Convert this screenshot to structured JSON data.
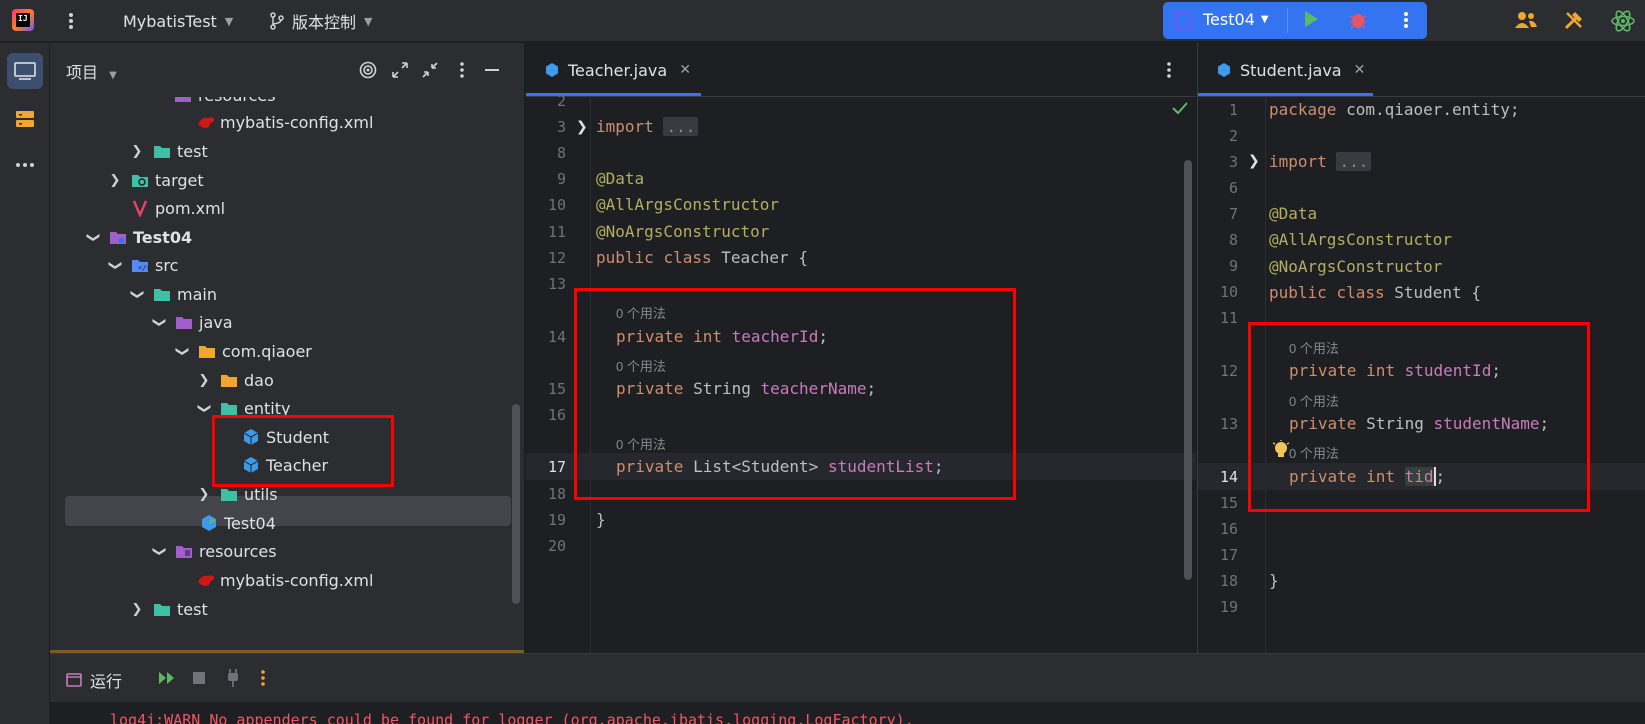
{
  "topbar": {
    "project_name": "MybatisTest",
    "vcs_label": "版本控制",
    "run_config": "Test04"
  },
  "project_panel": {
    "title": "项目",
    "tree": [
      {
        "label": "resources",
        "depth": 5
      },
      {
        "label": "mybatis-config.xml",
        "depth": 6
      },
      {
        "label": "test",
        "depth": 3
      },
      {
        "label": "target",
        "depth": 2
      },
      {
        "label": "pom.xml",
        "depth": 2
      },
      {
        "label": "Test04",
        "depth": 1
      },
      {
        "label": "src",
        "depth": 2
      },
      {
        "label": "main",
        "depth": 3
      },
      {
        "label": "java",
        "depth": 4
      },
      {
        "label": "com.qiaoer",
        "depth": 5
      },
      {
        "label": "dao",
        "depth": 6
      },
      {
        "label": "entity",
        "depth": 6
      },
      {
        "label": "Student",
        "depth": 7
      },
      {
        "label": "Teacher",
        "depth": 7
      },
      {
        "label": "utils",
        "depth": 6
      },
      {
        "label": "Test04",
        "depth": 5
      },
      {
        "label": "resources",
        "depth": 4
      },
      {
        "label": "mybatis-config.xml",
        "depth": 5
      },
      {
        "label": "test",
        "depth": 3
      }
    ]
  },
  "editor_left": {
    "tab": "Teacher.java",
    "lines": [
      "2",
      "3",
      "8",
      "9",
      "10",
      "11",
      "12",
      "13",
      "14",
      "15",
      "16",
      "17",
      "18",
      "19",
      "20"
    ],
    "code": {
      "import": "import",
      "fold": "...",
      "data": "@Data",
      "all_args": "@AllArgsConstructor",
      "no_args": "@NoArgsConstructor",
      "kw_public": "public",
      "kw_class": "class",
      "class_name": "Teacher",
      "brace_open": "{",
      "usage": "0 个用法",
      "kw_private": "private",
      "kw_int": "int",
      "field1": "teacherId",
      "type_string": "String",
      "field2": "teacherName",
      "type_list": "List<Student>",
      "field3": "studentList",
      "semi": ";",
      "brace_close": "}"
    }
  },
  "editor_right": {
    "tab": "Student.java",
    "lines": [
      "1",
      "2",
      "3",
      "6",
      "7",
      "8",
      "9",
      "10",
      "11",
      "12",
      "13",
      "14",
      "15",
      "16",
      "17",
      "18",
      "19"
    ],
    "code": {
      "package_kw": "package",
      "package_name": "com.qiaoer.entity;",
      "class_name": "Student",
      "field1": "studentId",
      "field2": "studentName",
      "field3": "tid"
    }
  },
  "run_panel": {
    "title": "运行",
    "console_line": "log4j:WARN No appenders could be found for logger (org.apache.ibatis.logging.LogFactory)."
  }
}
